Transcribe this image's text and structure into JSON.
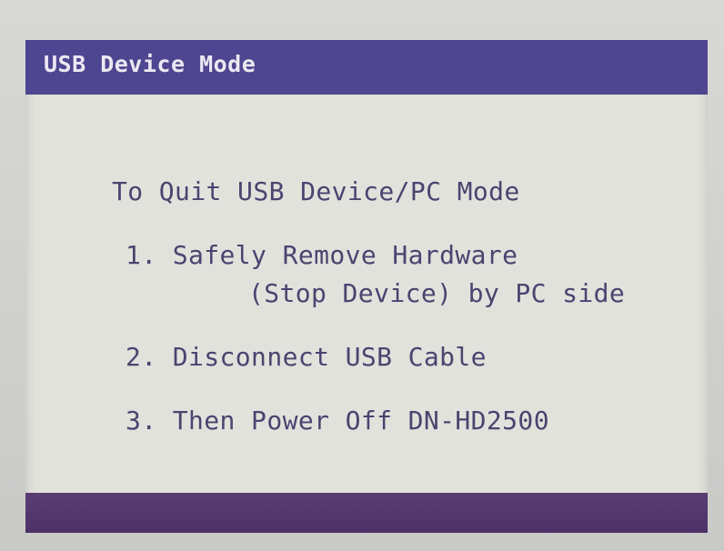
{
  "window": {
    "title": "USB Device Mode"
  },
  "content": {
    "heading": "To Quit USB Device/PC Mode",
    "steps": [
      {
        "line1": "1. Safely Remove Hardware",
        "line2": "(Stop Device) by PC side"
      },
      {
        "line1": "2. Disconnect USB Cable"
      },
      {
        "line1": "3. Then Power Off DN-HD2500"
      }
    ]
  },
  "colors": {
    "title_bar": "#4e4690",
    "screen_bg": "#e2e2dc",
    "text": "#4a4470",
    "bottom_bar": "#55386e"
  }
}
